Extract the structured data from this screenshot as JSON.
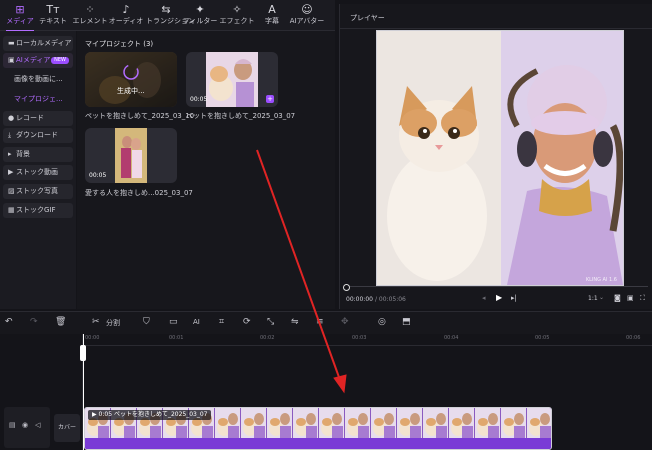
{
  "toolbar": {
    "tabs": [
      {
        "label": "メディア",
        "icon": "media-icon",
        "glyph": "⊞"
      },
      {
        "label": "テキスト",
        "icon": "text-icon",
        "glyph": "Tт"
      },
      {
        "label": "エレメント",
        "icon": "element-icon",
        "glyph": "⁘"
      },
      {
        "label": "オーディオ",
        "icon": "audio-icon",
        "glyph": "♪"
      },
      {
        "label": "トランジション",
        "icon": "transition-icon",
        "glyph": "⇆"
      },
      {
        "label": "フィルター",
        "icon": "filter-icon",
        "glyph": "✦"
      },
      {
        "label": "エフェクト",
        "icon": "effect-icon",
        "glyph": "✧"
      },
      {
        "label": "字幕",
        "icon": "subtitle-icon",
        "glyph": "A"
      },
      {
        "label": "AIアバター",
        "icon": "ai-avatar-icon",
        "glyph": "☺"
      }
    ],
    "active_index": 0
  },
  "sidebar": {
    "local_media": "ローカルメディア",
    "ai_media": "AIメディア",
    "new_badge": "NEW",
    "sub_image_to_video": "画像を動画に...",
    "sub_my_project": "マイプロジェ...",
    "record": "レコード",
    "download": "ダウンロード",
    "background": "背景",
    "stock_video": "ストック動画",
    "stock_photo": "ストック写真",
    "stock_gif": "ストックGIF"
  },
  "media": {
    "section_title": "マイプロジェクト (3)",
    "items": [
      {
        "caption": "ペットを抱きしめて_2025_03_10",
        "status": "生成中..."
      },
      {
        "caption": "ペットを抱きしめて_2025_03_07",
        "duration": "00:05"
      },
      {
        "caption": "愛する人を抱きしめ...025_03_07",
        "duration": "00:05"
      }
    ]
  },
  "player": {
    "title": "プレイヤー",
    "watermark": "KLING AI 1.6",
    "current_time": "00:00:00",
    "total_time": "/ 00:05:06",
    "ratio": "1:1"
  },
  "timeline": {
    "split_label": "分割",
    "ticks": [
      "00:00",
      "00:01",
      "00:02",
      "00:03",
      "00:04",
      "00:05",
      "00:06"
    ],
    "cover_label": "カバー",
    "clip_duration": "0:05",
    "clip_title": "ペットを抱きしめて_2025_03_07"
  },
  "colors": {
    "accent": "#b26cff",
    "arrow": "#e02424",
    "clip": "#7a3bd6"
  }
}
